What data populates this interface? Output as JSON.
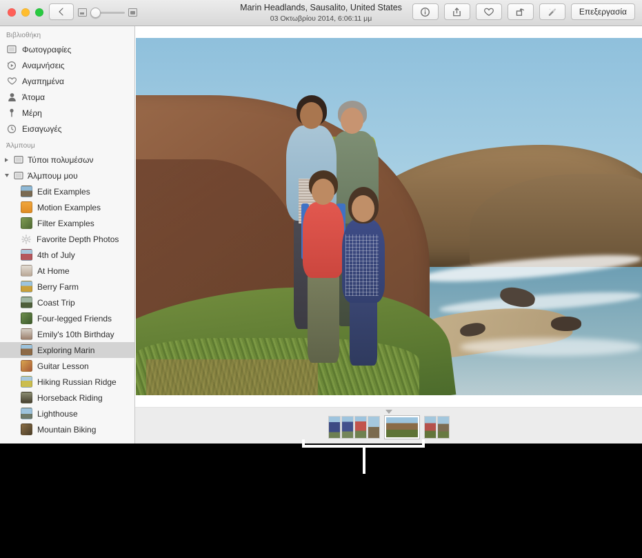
{
  "window": {
    "title": "Marin Headlands, Sausalito, United States",
    "subtitle": "03 Οκτωβρίου 2014, 6:06:11 μμ"
  },
  "traffic_lights": {
    "close": "close-button",
    "minimize": "minimize-button",
    "zoom": "zoom-button"
  },
  "toolbar": {
    "back_label": "‹",
    "zoom_slider": {
      "min_icon": "small-thumbnail-icon",
      "max_icon": "large-thumbnail-icon",
      "value": 0
    },
    "buttons": [
      {
        "name": "info-button",
        "icon": "info-icon"
      },
      {
        "name": "share-button",
        "icon": "share-icon"
      },
      {
        "name": "favorite-button",
        "icon": "heart-icon"
      },
      {
        "name": "rotate-button",
        "icon": "rotate-icon"
      },
      {
        "name": "enhance-button",
        "icon": "magic-wand-icon"
      }
    ],
    "edit_label": "Επεξεργασία"
  },
  "sidebar": {
    "library_header": "Βιβλιοθήκη",
    "library_items": [
      {
        "label": "Φωτογραφίες",
        "icon": "photos-icon"
      },
      {
        "label": "Αναμνήσεις",
        "icon": "memories-icon"
      },
      {
        "label": "Αγαπημένα",
        "icon": "heart-icon"
      },
      {
        "label": "Άτομα",
        "icon": "person-icon"
      },
      {
        "label": "Μέρη",
        "icon": "pin-icon"
      },
      {
        "label": "Εισαγωγές",
        "icon": "clock-icon"
      }
    ],
    "albums_header": "Άλμπουμ",
    "groups": [
      {
        "label": "Τύποι πολυμέσων",
        "expanded": false
      },
      {
        "label": "Άλμπουμ μου",
        "expanded": true
      }
    ],
    "albums": [
      {
        "label": "Edit Examples",
        "icon": "album-thumbnail",
        "selected": false
      },
      {
        "label": "Motion Examples",
        "icon": "album-thumbnail",
        "selected": false
      },
      {
        "label": "Filter Examples",
        "icon": "album-thumbnail",
        "selected": false
      },
      {
        "label": "Favorite Depth Photos",
        "icon": "gear-icon",
        "selected": false
      },
      {
        "label": "4th of July",
        "icon": "album-thumbnail",
        "selected": false
      },
      {
        "label": "At Home",
        "icon": "album-thumbnail",
        "selected": false
      },
      {
        "label": "Berry Farm",
        "icon": "album-thumbnail",
        "selected": false
      },
      {
        "label": "Coast Trip",
        "icon": "album-thumbnail",
        "selected": false
      },
      {
        "label": "Four-legged Friends",
        "icon": "album-thumbnail",
        "selected": false
      },
      {
        "label": "Emily's 10th Birthday",
        "icon": "album-thumbnail",
        "selected": false
      },
      {
        "label": "Exploring Marin",
        "icon": "album-thumbnail",
        "selected": true
      },
      {
        "label": "Guitar Lesson",
        "icon": "album-thumbnail",
        "selected": false
      },
      {
        "label": "Hiking Russian Ridge",
        "icon": "album-thumbnail",
        "selected": false
      },
      {
        "label": "Horseback Riding",
        "icon": "album-thumbnail",
        "selected": false
      },
      {
        "label": "Lighthouse",
        "icon": "album-thumbnail",
        "selected": false
      },
      {
        "label": "Mountain Biking",
        "icon": "album-thumbnail",
        "selected": false
      }
    ]
  },
  "main": {
    "photo_alt": "Family of four standing on a coastal hillside above the ocean at Marin Headlands",
    "filmstrip": {
      "marker": "selected-photo-marker",
      "groups": [
        {
          "thumbs": [
            {
              "name": "filmstrip-thumb-1",
              "selected": false
            },
            {
              "name": "filmstrip-thumb-2",
              "selected": false
            },
            {
              "name": "filmstrip-thumb-3",
              "selected": false
            },
            {
              "name": "filmstrip-thumb-4",
              "selected": false
            }
          ]
        },
        {
          "thumbs": [
            {
              "name": "filmstrip-thumb-5",
              "selected": true
            }
          ]
        },
        {
          "thumbs": [
            {
              "name": "filmstrip-thumb-6",
              "selected": false
            },
            {
              "name": "filmstrip-thumb-7",
              "selected": false
            }
          ]
        }
      ]
    }
  },
  "annotation": {
    "callout": "filmstrip-callout-bracket"
  },
  "colors": {
    "selection": "#d3d3d3",
    "titlebar_top": "#ececec",
    "titlebar_bottom": "#d8d8d8",
    "sidebar_bg": "#f7f7f7",
    "filmstrip_bg": "#ececec",
    "backdrop": "#000000"
  }
}
